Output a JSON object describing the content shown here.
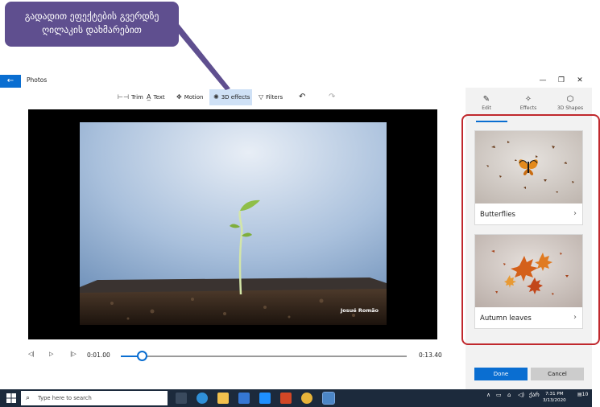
{
  "callout": {
    "text_line1": "გადადით ეფექტების გვერდზე",
    "text_line2": "ღილაკის დახმარებით"
  },
  "window": {
    "title": "Photos",
    "back_icon": "arrow-left-icon",
    "controls": {
      "minimize": "—",
      "maximize": "❐",
      "close": "✕"
    }
  },
  "toolbar": {
    "tools": [
      {
        "label": "Trim",
        "icon": "trim-icon"
      },
      {
        "label": "Text",
        "icon": "text-icon"
      },
      {
        "label": "Motion",
        "icon": "motion-icon"
      },
      {
        "label": "3D effects",
        "icon": "3d-effects-icon",
        "active": true
      },
      {
        "label": "Filters",
        "icon": "filters-icon"
      }
    ],
    "undo_icon": "undo-icon",
    "redo_icon": "redo-icon"
  },
  "preview": {
    "credit": "Josué Romão"
  },
  "playback": {
    "current_time": "0:01.00",
    "total_time": "0:13.40",
    "progress_fraction": 0.075
  },
  "side_panel": {
    "tabs": [
      {
        "label": "Edit",
        "icon": "pencil-icon",
        "active": true
      },
      {
        "label": "Effects",
        "icon": "effects-wand-icon"
      },
      {
        "label": "3D Shapes",
        "icon": "cube-icon"
      }
    ],
    "effects": [
      {
        "label": "Butterflies"
      },
      {
        "label": "Autumn leaves"
      }
    ],
    "done_label": "Done",
    "cancel_label": "Cancel"
  },
  "taskbar": {
    "search_placeholder": "Type here to search",
    "time": "7:31 PM",
    "date": "3/13/2020",
    "language": "ქარ",
    "notification_count": "10"
  },
  "colors": {
    "accent": "#0a6ed1",
    "callout": "#5f4f8f",
    "highlight_border": "#c0282d",
    "taskbar": "#1c2a3c"
  }
}
